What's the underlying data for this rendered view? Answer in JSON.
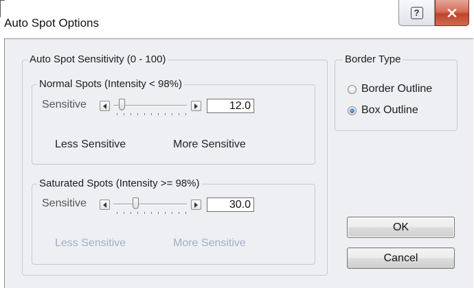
{
  "window": {
    "title": "Auto Spot Options",
    "help_glyph": "?",
    "close_glyph": "✕"
  },
  "sensitivity_group": {
    "title": "Auto Spot Sensitivity (0 - 100)",
    "normal": {
      "title": "Normal Spots (Intensity < 98%)",
      "row_label": "Sensitive",
      "value": "12.0",
      "slider_level": 12,
      "less_label": "Less Sensitive",
      "more_label": "More Sensitive"
    },
    "saturated": {
      "title": "Saturated Spots (Intensity >= 98%)",
      "row_label": "Sensitive",
      "value": "30.0",
      "slider_level": 30,
      "less_label": "Less Sensitive",
      "more_label": "More Sensitive"
    }
  },
  "border_group": {
    "title": "Border Type",
    "options": [
      {
        "label": "Border Outline",
        "checked": false
      },
      {
        "label": "Box Outline",
        "checked": true
      }
    ]
  },
  "buttons": {
    "ok": "OK",
    "cancel": "Cancel"
  },
  "colors": {
    "client_bg": "#eeeff2",
    "disabled_text": "#9fb0c8",
    "radio_dot": "#1c5fb4",
    "close_button": "#c0442a"
  },
  "icons": {
    "help": "help-icon",
    "close": "close-icon",
    "left_arrow": "arrow-left-icon",
    "right_arrow": "arrow-right-icon"
  }
}
